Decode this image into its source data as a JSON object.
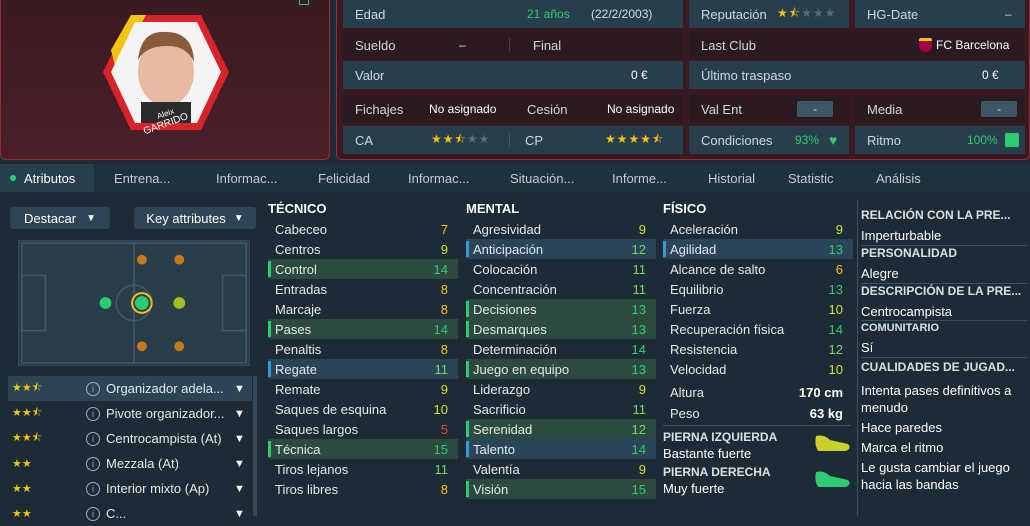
{
  "player": {
    "name_first": "Aleix",
    "name_last": "GARRIDO"
  },
  "info": {
    "edad_label": "Edad",
    "edad_val": "21 años",
    "edad_date": "(22/2/2003)",
    "reputacion_label": "Reputación",
    "reputacion_stars": 1.5,
    "hgdate_label": "HG-Date",
    "hgdate_val": "–",
    "sueldo_label": "Sueldo",
    "sueldo_val": "–",
    "final_label": "Final",
    "lastclub_label": "Last Club",
    "lastclub_val": "FC Barcelona",
    "valor_label": "Valor",
    "valor_val": "0 €",
    "traspaso_label": "Último traspaso",
    "traspaso_val": "0 €",
    "fichajes_label": "Fichajes",
    "fichajes_val": "No asignado",
    "cesion_label": "Cesión",
    "cesion_val": "No asignado",
    "valent_label": "Val Ent",
    "valent_val": "-",
    "media_label": "Media",
    "media_val": "-",
    "ca_label": "CA",
    "ca_stars": 2.5,
    "cp_label": "CP",
    "cp_stars": 4.5,
    "condiciones_label": "Condiciones",
    "condiciones_val": "93%",
    "ritmo_label": "Ritmo",
    "ritmo_val": "100%"
  },
  "tabs": [
    "Atributos",
    "Entrena...",
    "Informac...",
    "Felicidad",
    "Informac...",
    "Situación...",
    "Informe...",
    "Historial",
    "Statistic",
    "Análisis"
  ],
  "left": {
    "destacar": "Destacar",
    "key_attributes": "Key attributes",
    "roles": [
      {
        "name": "Organizador adela...",
        "stars": 2.5
      },
      {
        "name": "Pivote organizador...",
        "stars": 2.5
      },
      {
        "name": "Centrocampista (At)",
        "stars": 2.5
      },
      {
        "name": "Mezzala (At)",
        "stars": 2
      },
      {
        "name": "Interior mixto (Ap)",
        "stars": 2
      },
      {
        "name": "C...",
        "stars": 2
      }
    ]
  },
  "tecnico": {
    "title": "TÉCNICO",
    "attrs": [
      {
        "n": "Cabeceo",
        "v": "7"
      },
      {
        "n": "Centros",
        "v": "9"
      },
      {
        "n": "Control",
        "v": "14"
      },
      {
        "n": "Entradas",
        "v": "8"
      },
      {
        "n": "Marcaje",
        "v": "8"
      },
      {
        "n": "Pases",
        "v": "14"
      },
      {
        "n": "Penaltis",
        "v": "8"
      },
      {
        "n": "Regate",
        "v": "11"
      },
      {
        "n": "Remate",
        "v": "9"
      },
      {
        "n": "Saques de esquina",
        "v": "10"
      },
      {
        "n": "Saques largos",
        "v": "5"
      },
      {
        "n": "Técnica",
        "v": "15"
      },
      {
        "n": "Tiros lejanos",
        "v": "11"
      },
      {
        "n": "Tiros libres",
        "v": "8"
      }
    ]
  },
  "mental": {
    "title": "MENTAL",
    "attrs": [
      {
        "n": "Agresividad",
        "v": "9"
      },
      {
        "n": "Anticipación",
        "v": "12"
      },
      {
        "n": "Colocación",
        "v": "11"
      },
      {
        "n": "Concentración",
        "v": "11"
      },
      {
        "n": "Decisiones",
        "v": "13"
      },
      {
        "n": "Desmarques",
        "v": "13"
      },
      {
        "n": "Determinación",
        "v": "14"
      },
      {
        "n": "Juego en equipo",
        "v": "13"
      },
      {
        "n": "Liderazgo",
        "v": "9"
      },
      {
        "n": "Sacrificio",
        "v": "11"
      },
      {
        "n": "Serenidad",
        "v": "12"
      },
      {
        "n": "Talento",
        "v": "14"
      },
      {
        "n": "Valentía",
        "v": "9"
      },
      {
        "n": "Visión",
        "v": "15"
      }
    ]
  },
  "fisico": {
    "title": "FÍSICO",
    "attrs": [
      {
        "n": "Aceleración",
        "v": "9"
      },
      {
        "n": "Agilidad",
        "v": "13"
      },
      {
        "n": "Alcance de salto",
        "v": "6"
      },
      {
        "n": "Equilibrio",
        "v": "13"
      },
      {
        "n": "Fuerza",
        "v": "10"
      },
      {
        "n": "Recuperación física",
        "v": "14"
      },
      {
        "n": "Resistencia",
        "v": "12"
      },
      {
        "n": "Velocidad",
        "v": "10"
      }
    ],
    "altura_label": "Altura",
    "altura_val": "170 cm",
    "peso_label": "Peso",
    "peso_val": "63 kg",
    "pierna_izq_label": "PIERNA IZQUIERDA",
    "pierna_izq_val": "Bastante fuerte",
    "pierna_der_label": "PIERNA DERECHA",
    "pierna_der_val": "Muy fuerte"
  },
  "right": {
    "relacion_title": "RELACIÓN CON LA PRE...",
    "relacion_val": "Imperturbable",
    "personalidad_title": "PERSONALIDAD",
    "personalidad_val": "Alegre",
    "descripcion_title": "DESCRIPCIÓN DE LA PRE...",
    "descripcion_val": "Centrocampista",
    "comunitario_title": "COMUNITARIO",
    "comunitario_val": "Sí",
    "cualidades_title": "CUALIDADES DE JUGAD...",
    "cualidades": [
      "Intenta pases definitivos a menudo",
      "Hace paredes",
      "Marca el ritmo",
      "Le gusta cambiar el juego hacia las bandas"
    ]
  }
}
